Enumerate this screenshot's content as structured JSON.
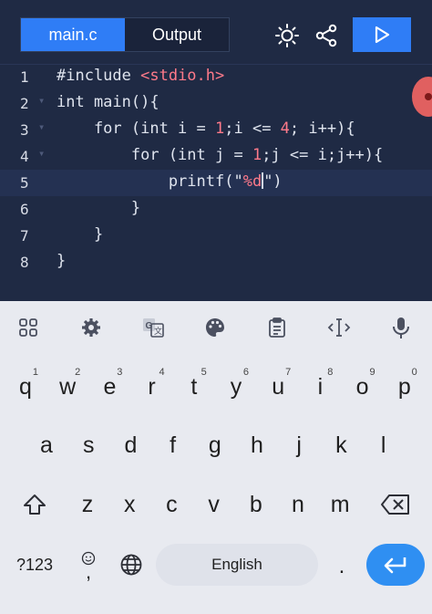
{
  "tabs": {
    "main": "main.c",
    "output": "Output"
  },
  "toolbar": {
    "theme_icon": "sun-icon",
    "share_icon": "share-icon",
    "run_icon": "play-icon"
  },
  "code": {
    "lines": [
      {
        "n": "1",
        "text": "#include <stdio.h>"
      },
      {
        "n": "2",
        "text": "int main(){"
      },
      {
        "n": "3",
        "text": "    for (int i = 1;i <= 4; i++){"
      },
      {
        "n": "4",
        "text": "        for (int j = 1;j <= i;j++){"
      },
      {
        "n": "5",
        "text": "            printf(\"%d\")"
      },
      {
        "n": "6",
        "text": "        }"
      },
      {
        "n": "7",
        "text": "    }"
      },
      {
        "n": "8",
        "text": "}"
      }
    ]
  },
  "keyboard": {
    "row1": [
      "q",
      "w",
      "e",
      "r",
      "t",
      "y",
      "u",
      "i",
      "o",
      "p"
    ],
    "row1_numbers": [
      "1",
      "2",
      "3",
      "4",
      "5",
      "6",
      "7",
      "8",
      "9",
      "0"
    ],
    "row2": [
      "a",
      "s",
      "d",
      "f",
      "g",
      "h",
      "j",
      "k",
      "l"
    ],
    "row3": [
      "z",
      "x",
      "c",
      "v",
      "b",
      "n",
      "m"
    ],
    "symbols_label": "?123",
    "comma": ",",
    "space_label": "English",
    "period": "."
  },
  "colors": {
    "accent": "#2f7df6",
    "editor_bg": "#1f2a44",
    "keyboard_bg": "#e8eaf0"
  }
}
